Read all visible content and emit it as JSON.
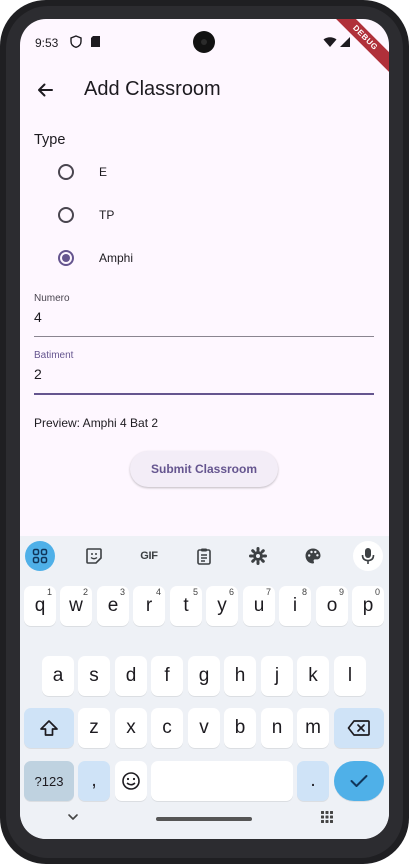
{
  "status": {
    "time": "9:53",
    "debug_label": "DEBUG"
  },
  "app_bar": {
    "title": "Add Classroom"
  },
  "form": {
    "type_label": "Type",
    "types": [
      {
        "label": "E",
        "selected": false
      },
      {
        "label": "TP",
        "selected": false
      },
      {
        "label": "Amphi",
        "selected": true
      }
    ],
    "numero": {
      "label": "Numero",
      "value": "4"
    },
    "batiment": {
      "label": "Batiment",
      "value": "2"
    },
    "preview": "Preview: Amphi 4 Bat 2",
    "submit_label": "Submit Classroom"
  },
  "keyboard": {
    "toolbar": {
      "apps_icon": "grid-icon",
      "sticker_icon": "sticker-icon",
      "gif_label": "GIF",
      "clipboard_icon": "clipboard-icon",
      "settings_icon": "gear-icon",
      "theme_icon": "palette-icon",
      "mic_icon": "mic-icon"
    },
    "row1": [
      {
        "key": "q",
        "hint": "1"
      },
      {
        "key": "w",
        "hint": "2"
      },
      {
        "key": "e",
        "hint": "3"
      },
      {
        "key": "r",
        "hint": "4"
      },
      {
        "key": "t",
        "hint": "5"
      },
      {
        "key": "y",
        "hint": "6"
      },
      {
        "key": "u",
        "hint": "7"
      },
      {
        "key": "i",
        "hint": "8"
      },
      {
        "key": "o",
        "hint": "9"
      },
      {
        "key": "p",
        "hint": "0"
      }
    ],
    "row2": [
      "a",
      "s",
      "d",
      "f",
      "g",
      "h",
      "j",
      "k",
      "l"
    ],
    "row3": [
      "z",
      "x",
      "c",
      "v",
      "b",
      "n",
      "m"
    ],
    "symbols_label": "?123",
    "comma_label": ",",
    "period_label": "."
  },
  "colors": {
    "accent": "#65558f",
    "background": "#fef7ff",
    "keyboard_accent": "#4fb0e8"
  }
}
